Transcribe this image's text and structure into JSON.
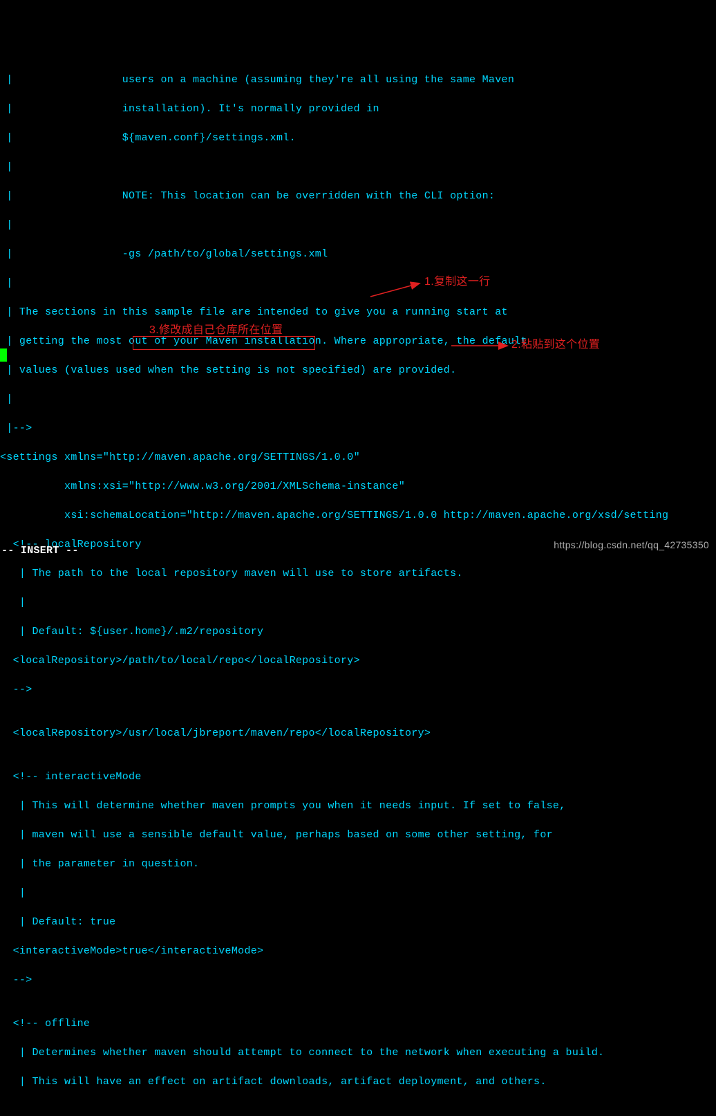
{
  "lines": {
    "l01": " |                 users on a machine (assuming they're all using the same Maven",
    "l02": " |                 installation). It's normally provided in",
    "l03": " |                 ${maven.conf}/settings.xml.",
    "l04": " |",
    "l05": " |                 NOTE: This location can be overridden with the CLI option:",
    "l06": " |",
    "l07": " |                 -gs /path/to/global/settings.xml",
    "l08": " |",
    "l09": " | The sections in this sample file are intended to give you a running start at",
    "l10": " | getting the most out of your Maven installation. Where appropriate, the default",
    "l11": " | values (values used when the setting is not specified) are provided.",
    "l12": " |",
    "l13": " |-->",
    "l14": "<settings xmlns=\"http://maven.apache.org/SETTINGS/1.0.0\"",
    "l15": "          xmlns:xsi=\"http://www.w3.org/2001/XMLSchema-instance\"",
    "l16": "          xsi:schemaLocation=\"http://maven.apache.org/SETTINGS/1.0.0 http://maven.apache.org/xsd/setting",
    "l17": "  <!-- localRepository",
    "l18": "   | The path to the local repository maven will use to store artifacts.",
    "l19": "   |",
    "l20": "   | Default: ${user.home}/.m2/repository",
    "l21a": "  <localRepository>/path/to/local/repo</localRepository>",
    "l22": "  -->",
    "l23": "",
    "l24a": "  <localRepository>",
    "l24b": "/usr/local/jbreport/maven/repo",
    "l24c": "</localRepository>",
    "l25": "",
    "l26": "  <!-- interactiveMode",
    "l27": "   | This will determine whether maven prompts you when it needs input. If set to false,",
    "l28": "   | maven will use a sensible default value, perhaps based on some other setting, for",
    "l29": "   | the parameter in question.",
    "l30": "   |",
    "l31": "   | Default: true",
    "l32": "  <interactiveMode>true</interactiveMode>",
    "l33": "  -->",
    "l34": "",
    "l35": "  <!-- offline",
    "l36": "   | Determines whether maven should attempt to connect to the network when executing a build.",
    "l37": "   | This will have an effect on artifact downloads, artifact deployment, and others."
  },
  "annotations": {
    "a1": "1.复制这一行",
    "a2": "2.粘贴到这个位置",
    "a3": "3.修改成自己仓库所在位置"
  },
  "status": "-- INSERT --",
  "watermark": "https://blog.csdn.net/qq_42735350"
}
